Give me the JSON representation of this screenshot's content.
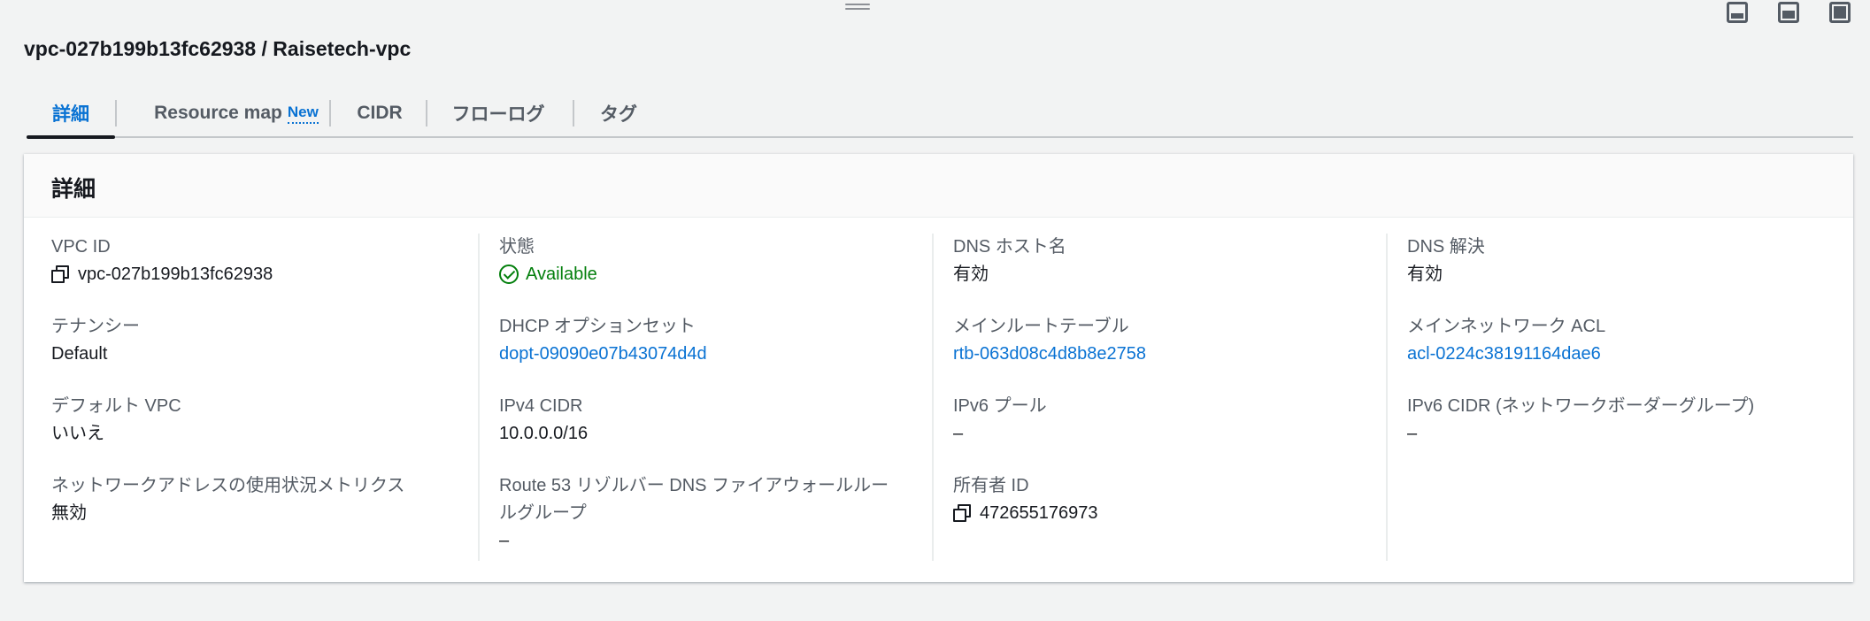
{
  "page": {
    "title": "vpc-027b199b13fc62938 / Raisetech-vpc"
  },
  "layout_icons": [
    "bottom-panel-icon",
    "side-panel-icon",
    "full-panel-icon"
  ],
  "tabs": [
    {
      "label": "詳細",
      "active": true
    },
    {
      "label": "Resource map",
      "badge": "New"
    },
    {
      "label": "CIDR"
    },
    {
      "label": "フローログ"
    },
    {
      "label": "タグ"
    }
  ],
  "details": {
    "title": "詳細",
    "columns": [
      [
        {
          "label": "VPC ID",
          "value": "vpc-027b199b13fc62938"
        },
        {
          "label": "テナンシー",
          "value": "Default"
        },
        {
          "label": "デフォルト VPC",
          "value": "いいえ"
        },
        {
          "label": "ネットワークアドレスの使用状況メトリクス",
          "value": "無効"
        }
      ],
      [
        {
          "label": "状態",
          "value": "Available"
        },
        {
          "label": "DHCP オプションセット",
          "value": "dopt-09090e07b43074d4d"
        },
        {
          "label": "IPv4 CIDR",
          "value": "10.0.0.0/16"
        },
        {
          "label_line1": "Route 53 リゾルバー DNS ファイアウォールルー",
          "label_line2": "ルグループ",
          "value": "–"
        }
      ],
      [
        {
          "label": "DNS ホスト名",
          "value": "有効"
        },
        {
          "label": "メインルートテーブル",
          "value": "rtb-063d08c4d8b8e2758"
        },
        {
          "label": "IPv6 プール",
          "value": "–"
        },
        {
          "label": "所有者 ID",
          "value": "472655176973"
        }
      ],
      [
        {
          "label": "DNS 解決",
          "value": "有効"
        },
        {
          "label": "メインネットワーク ACL",
          "value": "acl-0224c38191164dae6"
        },
        {
          "label": "IPv6 CIDR (ネットワークボーダーグループ)",
          "value": "–"
        }
      ]
    ]
  },
  "colors": {
    "link": "#0972d3",
    "success": "#037f0c",
    "text": "#16191f",
    "muted": "#545b64"
  }
}
